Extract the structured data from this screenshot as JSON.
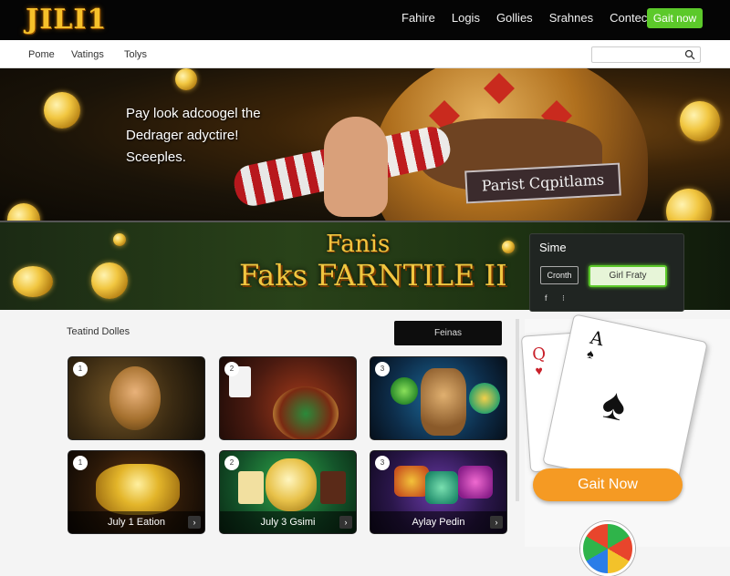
{
  "brand": {
    "logo": "JILI1"
  },
  "nav": {
    "links": [
      "Fahire",
      "Logis",
      "Gollies",
      "Srahnes",
      "Contect"
    ],
    "cta": "Gait now"
  },
  "subnav": {
    "links": [
      "Pome",
      "Vatings",
      "Tolys"
    ],
    "search_placeholder": ""
  },
  "hero": {
    "headline_lines": [
      "Pay look adcoogel the",
      "Dedrager adyctire!",
      "Sceeples."
    ],
    "banner": "Parist Cqpitlams"
  },
  "strip": {
    "title_line1": "Fanis",
    "title_line2": "Faks FARNTILE II",
    "panel": {
      "title": "Sime",
      "outline_button": "Cronth",
      "green_button": "Girl Fraty",
      "social_icons": [
        "f",
        "⁝"
      ]
    }
  },
  "games": {
    "section_label": "Teatind Dolles",
    "filter_button": "Feinas",
    "cards": [
      {
        "num": "1",
        "caption": ""
      },
      {
        "num": "2",
        "caption": ""
      },
      {
        "num": "3",
        "caption": ""
      },
      {
        "num": "1",
        "caption": "July 1 Eation"
      },
      {
        "num": "2",
        "caption": "July 3 Gsimi"
      },
      {
        "num": "3",
        "caption": "Aylay Pedin"
      }
    ]
  },
  "promo": {
    "card_q_rank": "Q",
    "card_a_rank": "A",
    "cta": "Gait Now"
  },
  "colors": {
    "accent_green": "#5cc92a",
    "accent_orange": "#f59a23",
    "gold": "#f1c640",
    "topnav_bg": "#050505"
  }
}
